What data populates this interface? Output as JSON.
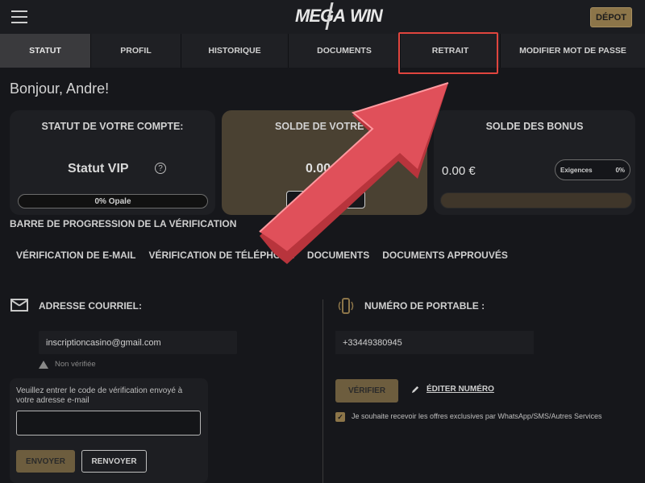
{
  "header": {
    "logo_left": "MEGA",
    "logo_right": "WIN",
    "deposit_label": "DÉPOT"
  },
  "tabs": [
    {
      "label": "STATUT",
      "active": true
    },
    {
      "label": "PROFIL",
      "active": false
    },
    {
      "label": "HISTORIQUE",
      "active": false
    },
    {
      "label": "DOCUMENTS",
      "active": false
    },
    {
      "label": "RETRAIT",
      "active": false,
      "highlighted": true
    },
    {
      "label": "MODIFIER MOT DE PASSE",
      "active": false
    }
  ],
  "greeting": "Bonjour, Andre!",
  "cards": {
    "status": {
      "title": "STATUT DE VOTRE COMPTE:",
      "vip_label": "Statut VIP",
      "help_icon": "?",
      "progress_label": "0% Opale"
    },
    "balance": {
      "title": "SOLDE DE VOTRE C",
      "amount": "0.00"
    },
    "bonus": {
      "title": "SOLDE DES BONUS",
      "amount": "0.00 €",
      "requirements_label": "Exigences",
      "requirements_value": "0%"
    }
  },
  "verification": {
    "title": "BARRE DE PROGRESSION DE LA VÉRIFICATION",
    "tabs": [
      "VÉRIFICATION DE E-MAIL",
      "VÉRIFICATION DE TÉLÉPHONE",
      "DOCUMENTS",
      "DOCUMENTS APPROUVÉS"
    ]
  },
  "email": {
    "label": "ADRESSE COURRIEL:",
    "value": "inscriptioncasino@gmail.com",
    "status": "Non vérifiée",
    "code_prompt": "Veuillez entrer le code de vérification envoyé à votre adresse e-mail",
    "send_label": "ENVOYER",
    "resend_label": "RENVOYER"
  },
  "phone": {
    "label": "NUMÉRO DE PORTABLE :",
    "value": "+33449380945",
    "verify_label": "VÉRIFIER",
    "edit_label": "ÉDITER NUMÉRO",
    "optin_text": "Je souhaite recevoir les offres exclusives par WhatsApp/SMS/Autres Services",
    "optin_checked": true
  },
  "colors": {
    "background": "#16171b",
    "accent_gold": "#8c7549",
    "highlight_red": "#e0453e",
    "arrow_red": "#e0505a"
  }
}
